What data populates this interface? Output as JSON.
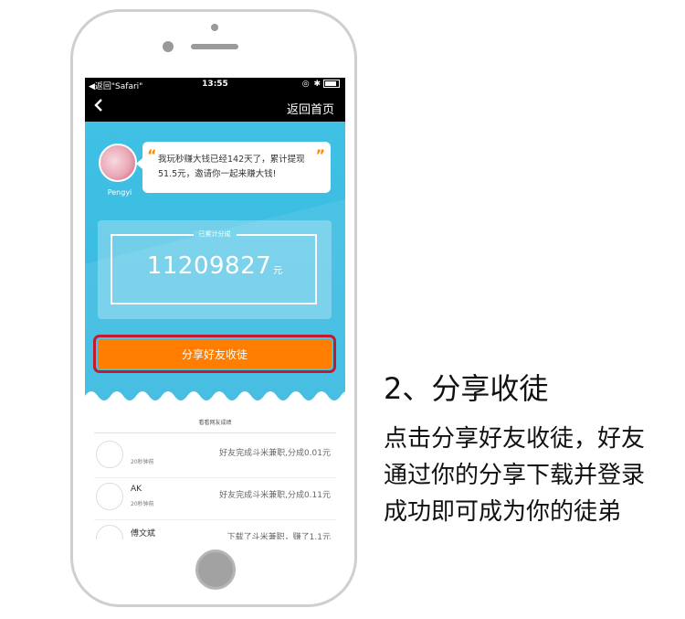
{
  "status_bar": {
    "back_app": "◀返回\"Safari\"",
    "time": "13:55",
    "icons": "◎ ✱"
  },
  "nav": {
    "back_icon": "chevron-left-icon",
    "home_label": "返回首页"
  },
  "profile": {
    "name": "Pengyi",
    "quote_open": "“",
    "quote_close": "”",
    "message": "我玩秒赚大钱已经142天了，累计提现51.5元，邀请你一起来赚大钱!"
  },
  "totals": {
    "label": "已累计分成",
    "amount": "11209827",
    "unit": "元"
  },
  "share_button": {
    "label": "分享好友收徒"
  },
  "list": {
    "caption": "看看网友成绩",
    "rows": [
      {
        "name": "",
        "time": "20秒钟前",
        "message": "好友完成斗米兼职,分成0.01元"
      },
      {
        "name": "AK",
        "time": "20秒钟前",
        "message": "好友完成斗米兼职,分成0.11元"
      },
      {
        "name": "傅文斌",
        "time": "",
        "message": "下载了斗米兼职，赚了1.1元"
      }
    ]
  },
  "annotation": {
    "step_title": "2、分享收徒",
    "description": "点击分享好友收徒，好友通过你的分享下载并登录成功即可成为你的徒弟"
  },
  "colors": {
    "hero_blue": "#3fc0e4",
    "share_orange": "#ff7d00",
    "highlight_red": "#c7192d",
    "quote_orange": "#ff8a00"
  }
}
